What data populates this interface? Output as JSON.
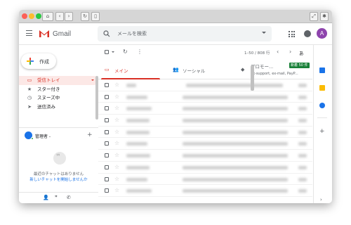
{
  "header": {
    "brand": "Gmail",
    "search_placeholder": "メールを検索",
    "avatar_letter": "A"
  },
  "compose": {
    "label": "作成"
  },
  "sidebar": {
    "items": [
      {
        "label": "受信トレイ",
        "icon": "inbox-icon",
        "active": true
      },
      {
        "label": "スター付き",
        "icon": "star-icon"
      },
      {
        "label": "スヌーズ中",
        "icon": "clock-icon"
      },
      {
        "label": "送信済み",
        "icon": "send-icon"
      }
    ]
  },
  "chat": {
    "user_label": "管理者 -",
    "empty_text": "最近のチャットはありません",
    "start_link": "新しいチャットを開始しませんか"
  },
  "toolbar": {
    "count": "1–50 / 808 行",
    "lang": "あ"
  },
  "tabs": [
    {
      "label": "メイン",
      "icon": "inbox-icon",
      "active": true
    },
    {
      "label": "ソーシャル",
      "icon": "people-icon"
    },
    {
      "label": "プロモー...",
      "icon": "tag-icon",
      "badge": "新着 50 件",
      "sub": "ax-support, ex-mail, PayP..."
    }
  ],
  "colors": {
    "accent": "#d93025",
    "link": "#1a73e8",
    "badge": "#188038"
  }
}
